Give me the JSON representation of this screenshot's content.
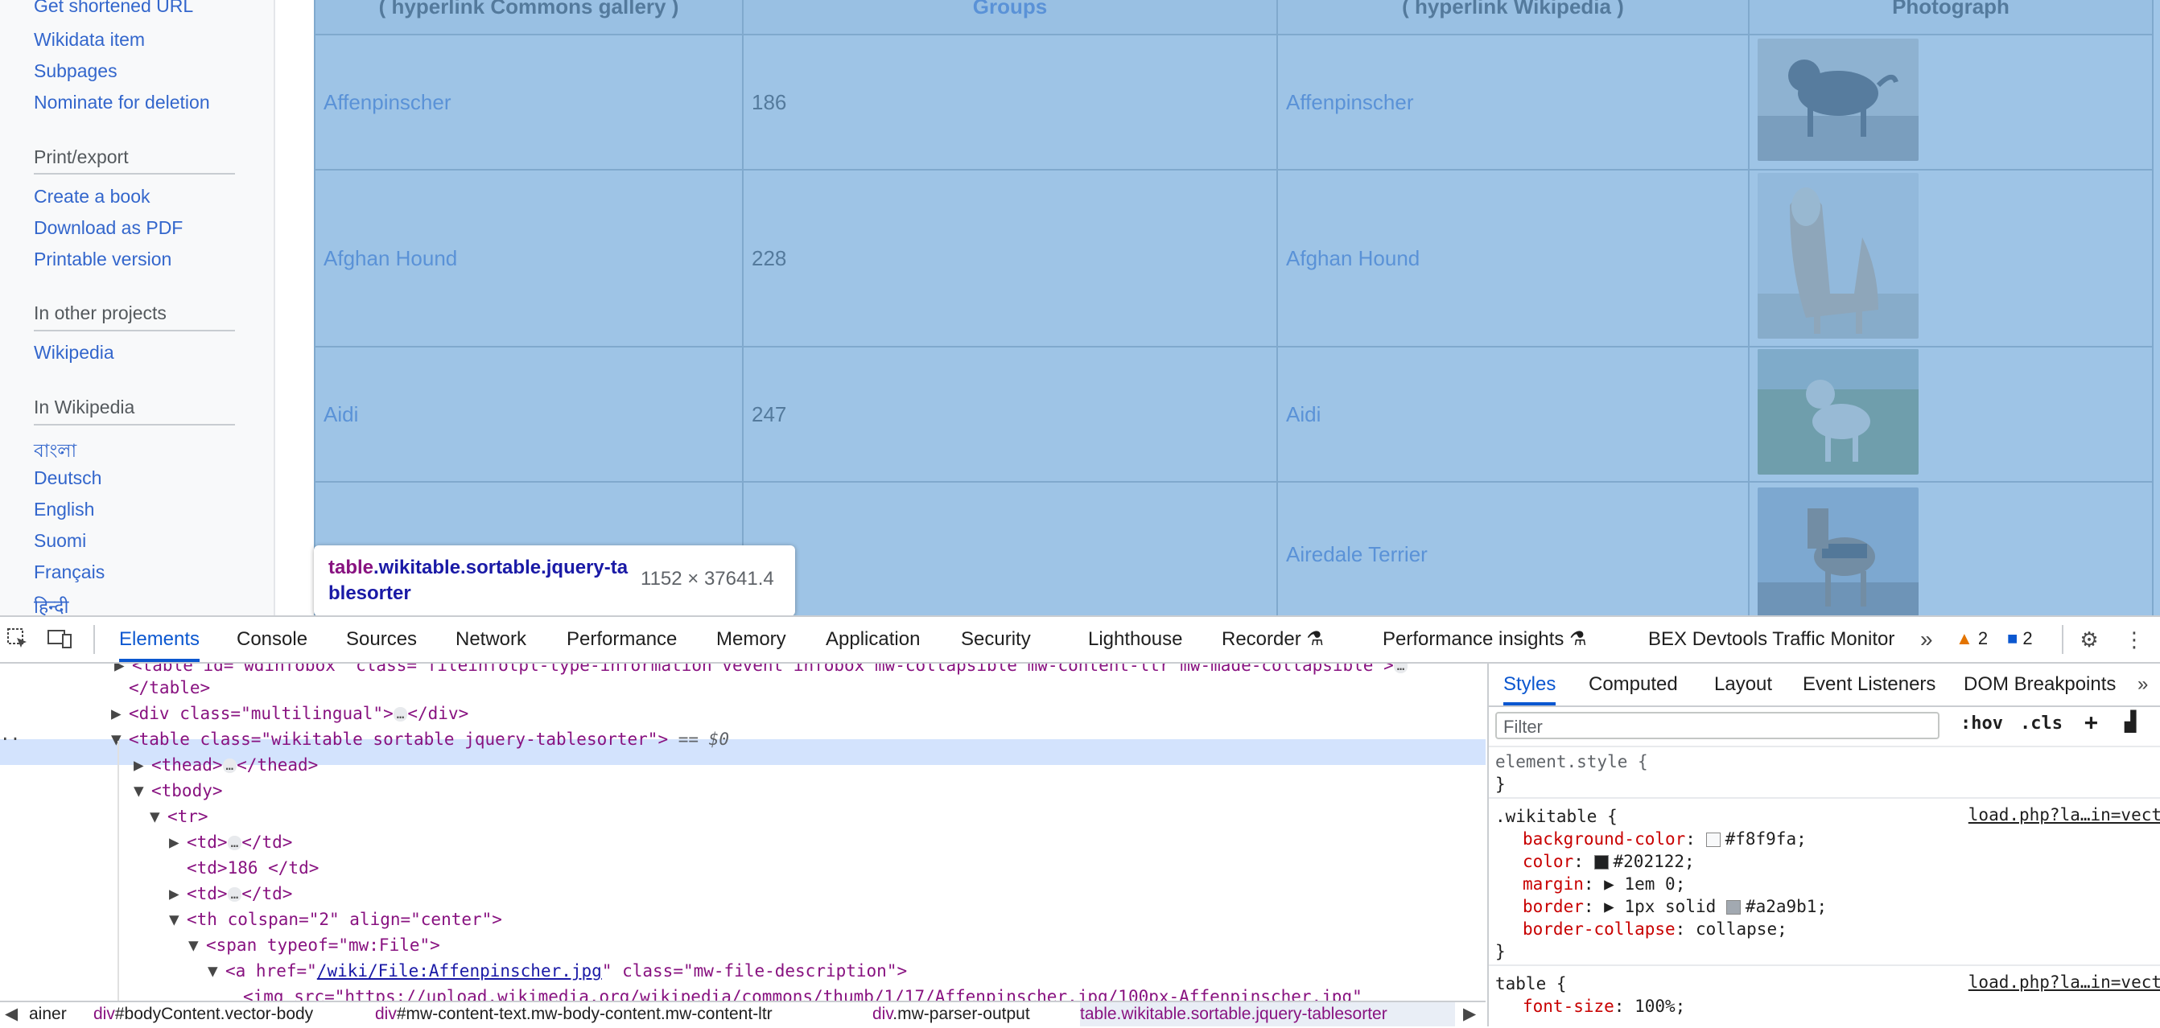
{
  "sidebar": {
    "links_top": [
      "Get shortened URL",
      "Wikidata item",
      "Subpages",
      "Nominate for deletion"
    ],
    "print_heading": "Print/export",
    "print_links": [
      "Create a book",
      "Download as PDF",
      "Printable version"
    ],
    "projects_heading": "In other projects",
    "projects_links": [
      "Wikipedia"
    ],
    "wikipedia_heading": "In Wikipedia",
    "languages": [
      "বাংলা",
      "Deutsch",
      "English",
      "Suomi",
      "Français",
      "हिन्दी"
    ]
  },
  "table": {
    "headers": [
      "( hyperlink Commons gallery )",
      "Groups",
      "( hyperlink Wikipedia )",
      "Photograph"
    ],
    "rows": [
      {
        "name": "Affenpinscher",
        "num": "186",
        "wiki": "Affenpinscher",
        "photo": "affenpinscher-photo"
      },
      {
        "name": "Afghan Hound",
        "num": "228",
        "wiki": "Afghan Hound",
        "photo": "afghan-hound-photo"
      },
      {
        "name": "Aidi",
        "num": "247",
        "wiki": "Aidi",
        "photo": "aidi-photo"
      },
      {
        "name": "",
        "num": "",
        "wiki": "Airedale Terrier",
        "photo": "airedale-terrier-photo"
      }
    ]
  },
  "tooltip": {
    "tag": "table",
    "classes": ".wikitable.sortable.jquery-tablesorter",
    "size": "1152 × 37641.4"
  },
  "devtools": {
    "tabs": [
      "Elements",
      "Console",
      "Sources",
      "Network",
      "Performance",
      "Memory",
      "Application",
      "Security",
      "Lighthouse",
      "Recorder",
      "Performance insights",
      "BEX Devtools Traffic Monitor"
    ],
    "active_tab": "Elements",
    "warnings_count": "2",
    "messages_count": "2",
    "more_tabs": "»",
    "dom_lines": {
      "l0": "<table id=\"wdinfobox\" class=\"fileinfotpl-type-information vevent infobox mw-collapsible mw-content-ltr mw-made-collapsible\">",
      "l1_tag": "</table>",
      "l2_open": "<div class=\"multilingual\">",
      "l2_close": "</div>",
      "l3_table": "<table class=\"wikitable sortable jquery-tablesorter\">",
      "l3_eq": "== $0",
      "l4_thead_open": "<thead>",
      "l4_thead_close": "</thead>",
      "l5_tbody": "<tbody>",
      "l6_tr": "<tr>",
      "l7_td_open": "<td>",
      "l7_td_close": "</td>",
      "l8_td": "<td>186 </td>",
      "l9_td_open": "<td>",
      "l9_td_close": "</td>",
      "l10_th": "<th colspan=\"2\" align=\"center\">",
      "l11_span": "<span typeof=\"mw:File\">",
      "l12_a_pre": "<a href=\"",
      "l12_a_href": "/wiki/File:Affenpinscher.jpg",
      "l12_a_post": "\" class=\"mw-file-description\">",
      "l13_img": "<img src=\"https://upload.wikimedia.org/wikipedia/commons/thumb/1/17/Affenpinscher.jpg/100px-Affenpinscher.jpg\""
    },
    "breadcrumbs": [
      {
        "text": "ainer",
        "id": ""
      },
      {
        "text": "div",
        "id": "#bodyContent.vector-body"
      },
      {
        "text": "div",
        "id": "#mw-content-text.mw-body-content.mw-content-ltr"
      },
      {
        "text": "div",
        "id": ".mw-parser-output"
      },
      {
        "text": "table",
        "id": ".wikitable.sortable.jquery-tablesorter"
      }
    ],
    "styles": {
      "tabs": [
        "Styles",
        "Computed",
        "Layout",
        "Event Listeners",
        "DOM Breakpoints"
      ],
      "active": "Styles",
      "filter_placeholder": "Filter",
      "hov": ":hov",
      "cls": ".cls",
      "element_style": "element.style {",
      "rule1_selector": ".wikitable {",
      "rule1_source": "load.php?la…in=vect",
      "rule1_props": [
        {
          "name": "background-color",
          "value": "#f8f9fa",
          "swatch": "#f8f9fa"
        },
        {
          "name": "color",
          "value": "#202122",
          "swatch": "#202122"
        },
        {
          "name": "margin",
          "value": "1em 0",
          "arrow": true
        },
        {
          "name": "border",
          "value": "1px solid",
          "arrow": true,
          "swatch": "#a2a9b1",
          "value2": "#a2a9b1"
        },
        {
          "name": "border-collapse",
          "value": "collapse"
        }
      ],
      "rule2_selector": "table {",
      "rule2_source": "load.php?la…in=vect",
      "rule2_props": [
        {
          "name": "font-size",
          "value": "100%"
        }
      ],
      "close_brace": "}"
    }
  }
}
